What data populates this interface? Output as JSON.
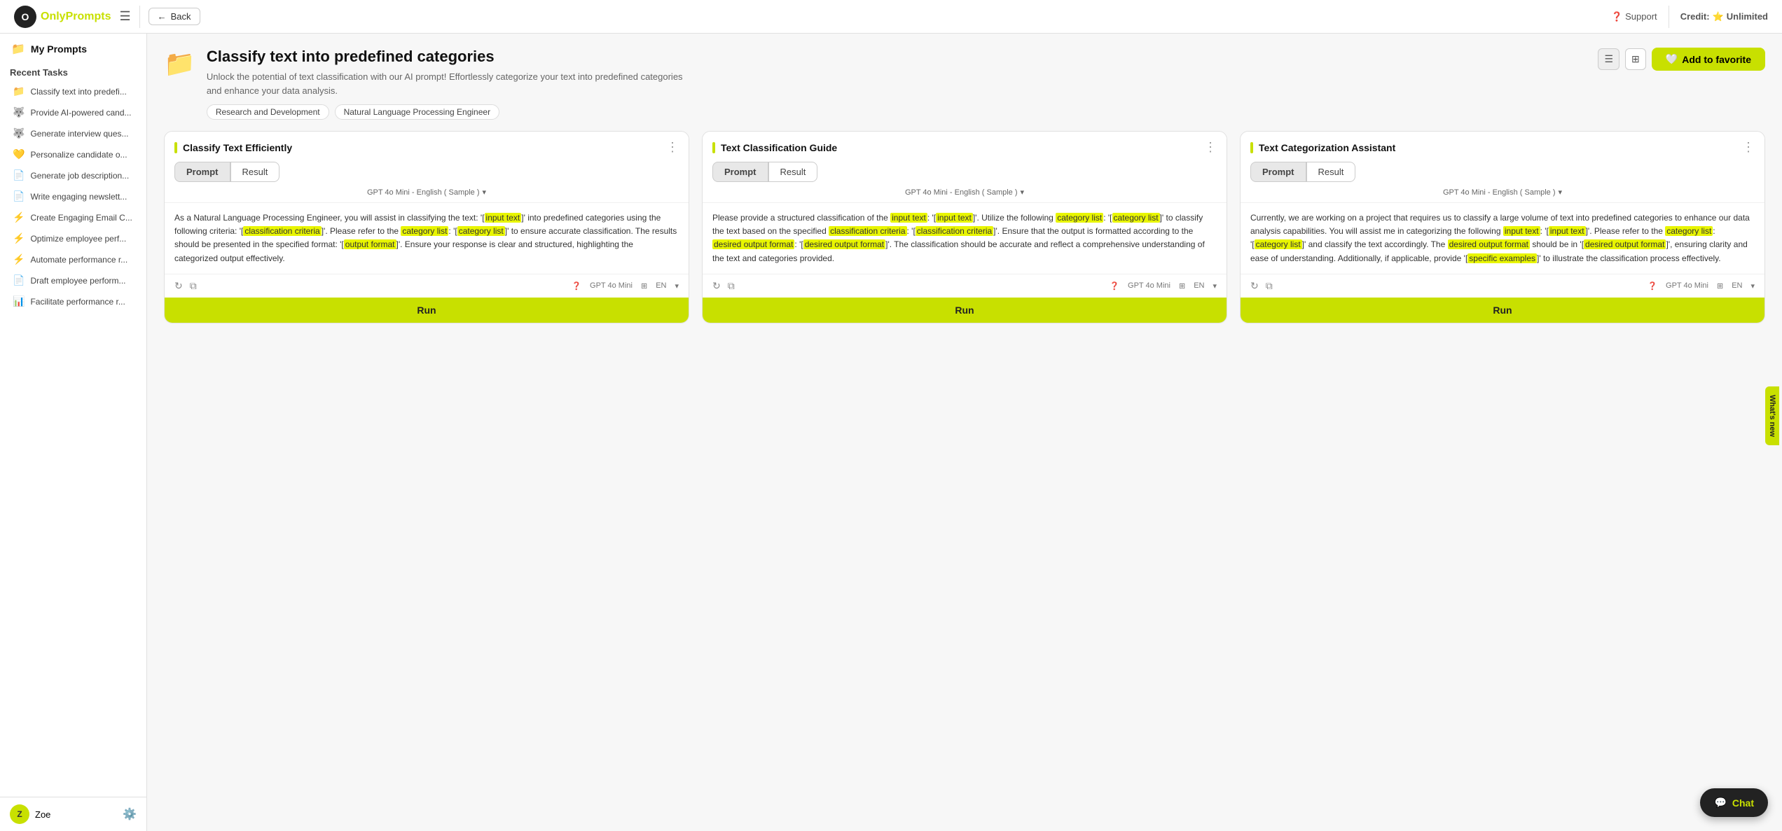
{
  "nav": {
    "logo_text": "Only",
    "logo_highlight": "Prompts",
    "back_label": "Back",
    "support_label": "Support",
    "credit_label": "Credit:",
    "credit_value": "Unlimited"
  },
  "sidebar": {
    "my_prompts_label": "My Prompts",
    "recent_tasks_label": "Recent Tasks",
    "items": [
      {
        "id": 1,
        "icon": "📁",
        "text": "Classify text into predefi..."
      },
      {
        "id": 2,
        "icon": "🐺",
        "text": "Provide AI-powered cand..."
      },
      {
        "id": 3,
        "icon": "🐺",
        "text": "Generate interview ques..."
      },
      {
        "id": 4,
        "icon": "💛",
        "text": "Personalize candidate o..."
      },
      {
        "id": 5,
        "icon": "📄",
        "text": "Generate job description..."
      },
      {
        "id": 6,
        "icon": "📄",
        "text": "Write engaging newslett..."
      },
      {
        "id": 7,
        "icon": "⚡",
        "text": "Create Engaging Email C..."
      },
      {
        "id": 8,
        "icon": "⚡",
        "text": "Optimize employee perf..."
      },
      {
        "id": 9,
        "icon": "⚡",
        "text": "Automate performance r..."
      },
      {
        "id": 10,
        "icon": "📄",
        "text": "Draft employee perform..."
      },
      {
        "id": 11,
        "icon": "📊",
        "text": "Facilitate performance r..."
      }
    ],
    "user_name": "Zoe"
  },
  "page": {
    "title": "Classify text into predefined categories",
    "description": "Unlock the potential of text classification with our AI prompt! Effortlessly categorize your text into predefined categories and enhance your data analysis.",
    "tags": [
      "Research and Development",
      "Natural Language Processing Engineer"
    ],
    "add_favorite_label": "Add to favorite"
  },
  "cards": [
    {
      "title": "Classify Text Efficiently",
      "accent_color": "#c8e000",
      "tabs": [
        "Prompt",
        "Result"
      ],
      "active_tab": "Prompt",
      "model": "GPT 4o Mini - English ( Sample )",
      "body": "As a Natural Language Processing Engineer, you will assist in classifying the text: '[input text]' into predefined categories using the following criteria: '[classification criteria]'. Please refer to the category list: '[category list]' to ensure accurate classification. The results should be presented in the specified format: '[output format]'. Ensure your response is clear and structured, highlighting the categorized output effectively.",
      "highlights": [
        "input text",
        "classification criteria",
        "category list",
        "output format"
      ],
      "footer_model": "GPT 4o Mini",
      "footer_lang": "EN",
      "run_label": "Run"
    },
    {
      "title": "Text Classification Guide",
      "accent_color": "#c8e000",
      "tabs": [
        "Prompt",
        "Result"
      ],
      "active_tab": "Prompt",
      "model": "GPT 4o Mini - English ( Sample )",
      "body": "Please provide a structured classification of the input text: '[input text]'. Utilize the following category list: '[category list]' to classify the text based on the specified classification criteria: '[classification criteria]'. Ensure that the output is formatted according to the desired output format: '[desired output format]'. The classification should be accurate and reflect a comprehensive understanding of the text and categories provided.",
      "highlights": [
        "input text",
        "category list",
        "classification criteria",
        "desired output format"
      ],
      "footer_model": "GPT 4o Mini",
      "footer_lang": "EN",
      "run_label": "Run"
    },
    {
      "title": "Text Categorization Assistant",
      "accent_color": "#c8e000",
      "tabs": [
        "Prompt",
        "Result"
      ],
      "active_tab": "Prompt",
      "model": "GPT 4o Mini - English ( Sample )",
      "body": "Currently, we are working on a project that requires us to classify a large volume of text into predefined categories to enhance our data analysis capabilities. You will assist me in categorizing the following input text: '[input text]'. Please refer to the category list: '[category list]' and classify the text accordingly. The desired output format should be in '[desired output format]', ensuring clarity and ease of understanding. Additionally, if applicable, provide '[specific examples]' to illustrate the classification process effectively.",
      "highlights": [
        "input text",
        "category list",
        "desired output format",
        "specific examples"
      ],
      "footer_model": "GPT 4o Mini",
      "footer_lang": "EN",
      "run_label": "Run"
    }
  ],
  "chat": {
    "label": "Chat"
  },
  "whats_new": {
    "label": "What's new"
  }
}
